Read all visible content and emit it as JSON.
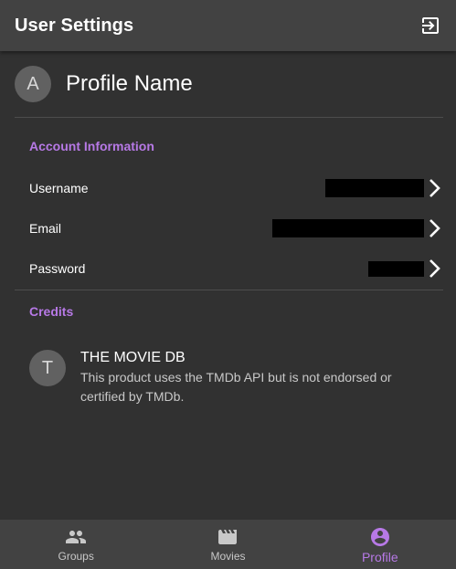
{
  "header": {
    "title": "User Settings",
    "logout_icon": "logout-icon"
  },
  "profile": {
    "avatar_initial": "A",
    "name": "Profile Name"
  },
  "account": {
    "section_title": "Account Information",
    "items": [
      {
        "label": "Username",
        "value_redacted": true
      },
      {
        "label": "Email",
        "value_redacted": true
      },
      {
        "label": "Password",
        "value_redacted": true
      }
    ]
  },
  "credits": {
    "section_title": "Credits",
    "item": {
      "avatar_initial": "T",
      "title": "THE MOVIE DB",
      "body": "This product uses the TMDb API but is not endorsed or certified by TMDb."
    }
  },
  "bottom_nav": {
    "items": [
      {
        "label": "Groups",
        "icon": "groups-icon",
        "active": false
      },
      {
        "label": "Movies",
        "icon": "movie-clapper-icon",
        "active": false
      },
      {
        "label": "Profile",
        "icon": "account-circle-icon",
        "active": true
      }
    ]
  },
  "colors": {
    "accent": "#b779e6",
    "background": "#313131",
    "app_bar": "#424242"
  }
}
